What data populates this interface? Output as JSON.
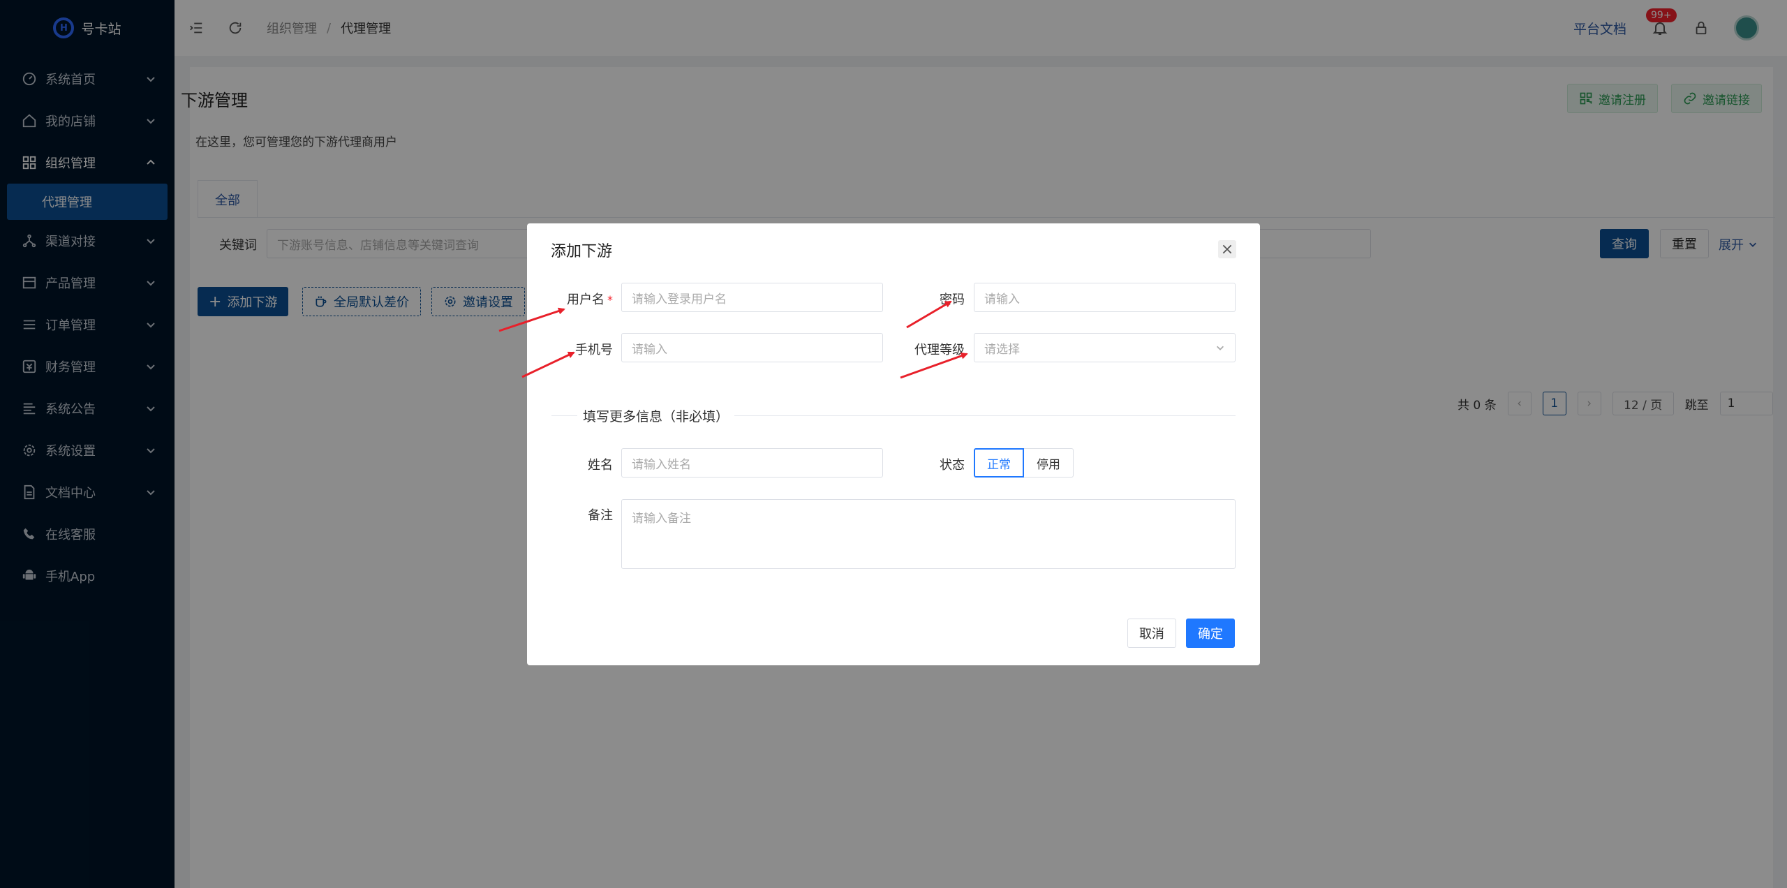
{
  "app": {
    "logo_text": "号卡站"
  },
  "sidebar": {
    "items": [
      {
        "label": "系统首页",
        "icon": "dashboard-icon"
      },
      {
        "label": "我的店铺",
        "icon": "home-icon"
      },
      {
        "label": "组织管理",
        "icon": "grid-icon"
      },
      {
        "label": "渠道对接",
        "icon": "network-icon"
      },
      {
        "label": "产品管理",
        "icon": "store-icon"
      },
      {
        "label": "订单管理",
        "icon": "list-icon"
      },
      {
        "label": "财务管理",
        "icon": "finance-icon"
      },
      {
        "label": "系统公告",
        "icon": "notice-icon"
      },
      {
        "label": "系统设置",
        "icon": "gear-icon"
      },
      {
        "label": "文档中心",
        "icon": "document-icon"
      },
      {
        "label": "在线客服",
        "icon": "phone-icon"
      },
      {
        "label": "手机App",
        "icon": "android-icon"
      }
    ],
    "active_sub": "代理管理"
  },
  "header": {
    "breadcrumb": [
      "组织管理",
      "/",
      "代理管理"
    ],
    "doc_link": "平台文档",
    "badge": "99+"
  },
  "page": {
    "title": "下游管理",
    "desc": "在这里，您可管理您的下游代理商用户",
    "invite_register": "邀请注册",
    "invite_link": "邀请链接",
    "tab_all": "全部",
    "keyword_label": "关键词",
    "keyword_placeholder": "下游账号信息、店铺信息等关键词查询",
    "query": "查询",
    "reset": "重置",
    "expand": "展开",
    "add_downstream": "添加下游",
    "global_default": "全局默认差价",
    "invite_settings": "邀请设置",
    "pager": {
      "total": "共 0 条",
      "current": "1",
      "page_size": "12 / 页",
      "jump_label": "跳至",
      "jump_value": "1"
    }
  },
  "modal": {
    "title": "添加下游",
    "username_label": "用户名",
    "username_placeholder": "请输入登录用户名",
    "password_label": "密码",
    "password_placeholder": "请输入",
    "phone_label": "手机号",
    "phone_placeholder": "请输入",
    "level_label": "代理等级",
    "level_placeholder": "请选择",
    "more_info": "填写更多信息（非必填）",
    "name_label": "姓名",
    "name_placeholder": "请输入姓名",
    "status_label": "状态",
    "status_on": "正常",
    "status_off": "停用",
    "remark_label": "备注",
    "remark_placeholder": "请输入备注",
    "cancel": "取消",
    "ok": "确定"
  },
  "colors": {
    "sidebar_bg": "#001529",
    "primary": "#0c4f94",
    "modal_primary": "#1f78ff",
    "annotation": "#e8202a"
  }
}
